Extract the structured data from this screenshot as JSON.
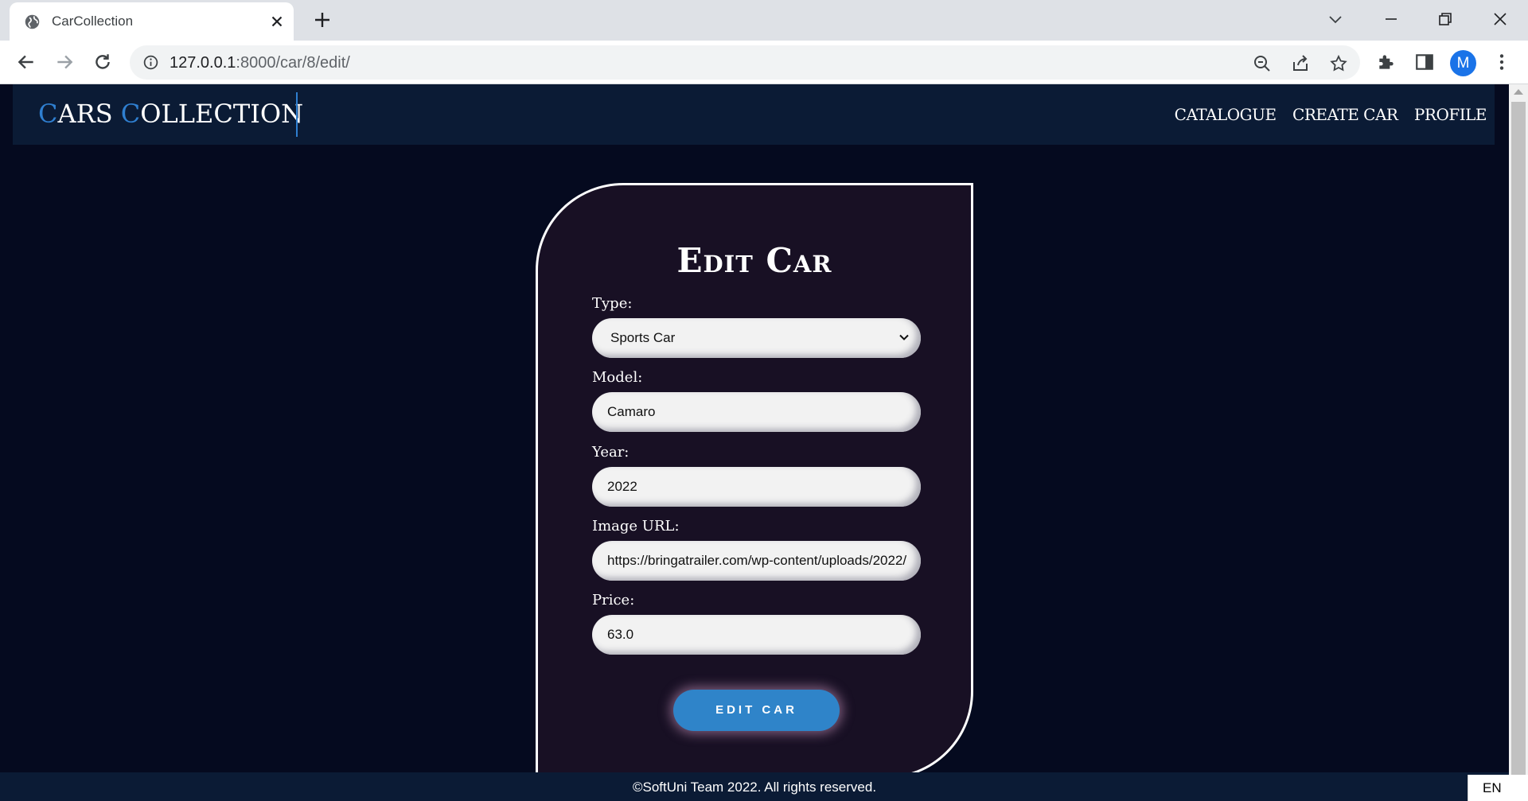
{
  "browser": {
    "tab_title": "CarCollection",
    "url_host": "127.0.0.1",
    "url_rest": ":8000/car/8/edit/",
    "avatar_letter": "M"
  },
  "header": {
    "logo_first_cap": "C",
    "logo_first_rest": "ARS ",
    "logo_second_cap": "C",
    "logo_second_rest": "OLLECTION",
    "nav": [
      "CATALOGUE",
      "CREATE CAR",
      "PROFILE"
    ]
  },
  "form": {
    "title": "Edit Car",
    "type_label": "Type:",
    "type_value": "Sports Car",
    "model_label": "Model:",
    "model_value": "Camaro",
    "year_label": "Year:",
    "year_value": "2022",
    "image_label": "Image URL:",
    "image_value": "https://bringatrailer.com/wp-content/uploads/2022/",
    "price_label": "Price:",
    "price_value": "63.0",
    "submit_label": "EDIT CAR"
  },
  "footer": {
    "copyright": "©SoftUni Team 2022. All rights reserved."
  },
  "taskbar": {
    "language": "EN"
  },
  "colors": {
    "page_bg": "#050a1f",
    "header_bg": "#0b1b35",
    "card_bg": "#181024",
    "accent": "#2f84c9"
  }
}
